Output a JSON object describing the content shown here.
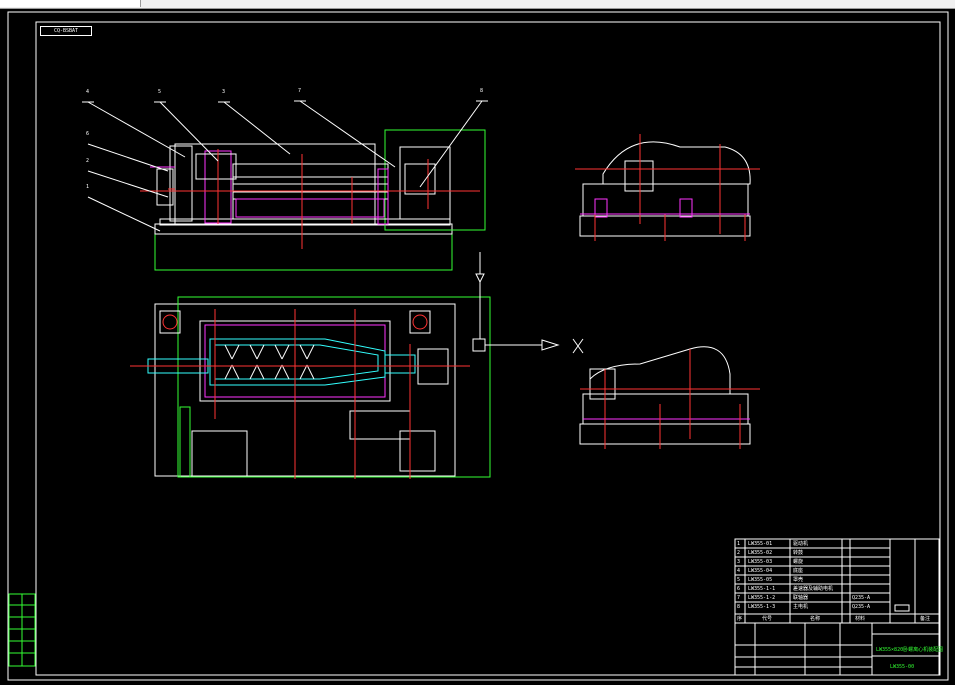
{
  "window": {
    "title_tab": ""
  },
  "drawing": {
    "code_box": "CQ-BSBAT",
    "view_markers": {
      "section_x": "X"
    },
    "callouts": [
      "4",
      "5",
      "3",
      "7",
      "8",
      "6",
      "2",
      "1"
    ]
  },
  "title_block": {
    "rows": [
      {
        "no": "1",
        "code": "LW355-01",
        "name": "驱动机"
      },
      {
        "no": "2",
        "code": "LW355-02",
        "name": "转鼓"
      },
      {
        "no": "3",
        "code": "LW355-03",
        "name": "螺旋"
      },
      {
        "no": "4",
        "code": "LW355-04",
        "name": "底座"
      },
      {
        "no": "5",
        "code": "LW355-05",
        "name": "罩壳"
      },
      {
        "no": "6",
        "code": "LW355-1-1",
        "name": "差速器及辅助电机"
      },
      {
        "no": "7",
        "code": "LW355-1-2",
        "name": "联轴器"
      },
      {
        "no": "8",
        "code": "LW355-1-3",
        "name": "主电机"
      }
    ],
    "materials": [
      "Q235-A",
      "Q235-A"
    ],
    "header": {
      "seq": "序",
      "code": "代号",
      "name": "名称",
      "material": "材料",
      "note": "备注"
    },
    "drawing_title": "LW355×820卧螺离心机装配图",
    "drawing_number": "LW355-00"
  },
  "left_strip": {
    "labels": [
      "",
      "",
      "",
      "",
      ""
    ]
  }
}
